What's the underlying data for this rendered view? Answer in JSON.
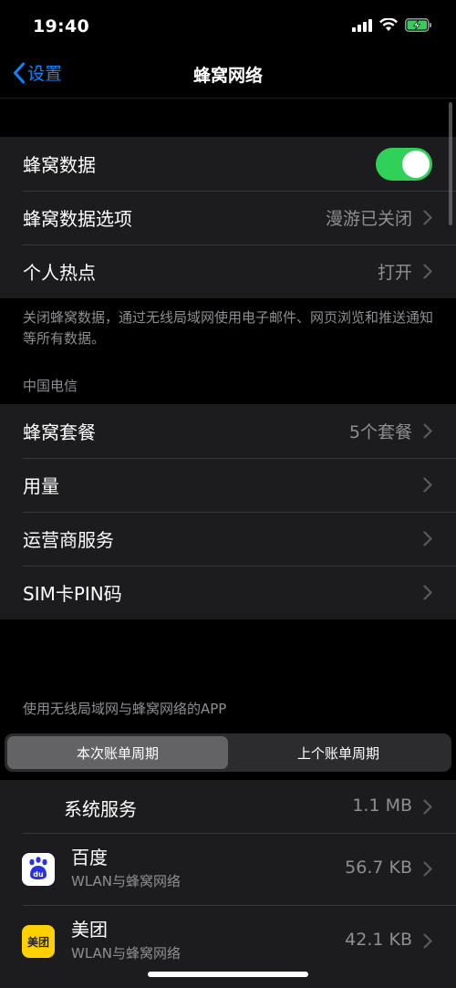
{
  "status": {
    "time": "19:40"
  },
  "nav": {
    "back_label": "设置",
    "title": "蜂窝网络"
  },
  "group1": {
    "cellular_data": {
      "label": "蜂窝数据",
      "enabled": true
    },
    "cellular_options": {
      "label": "蜂窝数据选项",
      "value": "漫游已关闭"
    },
    "hotspot": {
      "label": "个人热点",
      "value": "打开"
    }
  },
  "footnote": "关闭蜂窝数据，通过无线局域网使用电子邮件、网页浏览和推送通知等所有数据。",
  "carrier": {
    "header": "中国电信"
  },
  "group2": {
    "plans": {
      "label": "蜂窝套餐",
      "value": "5个套餐"
    },
    "usage": {
      "label": "用量"
    },
    "carrier_services": {
      "label": "运营商服务"
    },
    "sim_pin": {
      "label": "SIM卡PIN码"
    }
  },
  "apps_header": "使用无线局域网与蜂窝网络的APP",
  "segmented": {
    "current": "本次账单周期",
    "previous": "上个账单周期"
  },
  "apps": [
    {
      "name": "系统服务",
      "value": "1.1 MB"
    },
    {
      "name": "百度",
      "sub": "WLAN与蜂窝网络",
      "value": "56.7 KB",
      "icon_text": "du"
    },
    {
      "name": "美团",
      "sub": "WLAN与蜂窝网络",
      "value": "42.1 KB",
      "icon_text": "美团"
    }
  ],
  "colors": {
    "accent": "#0a84ff",
    "toggle_on": "#30d158",
    "meituan": "#ffd100",
    "baidu": "#2932e1"
  }
}
